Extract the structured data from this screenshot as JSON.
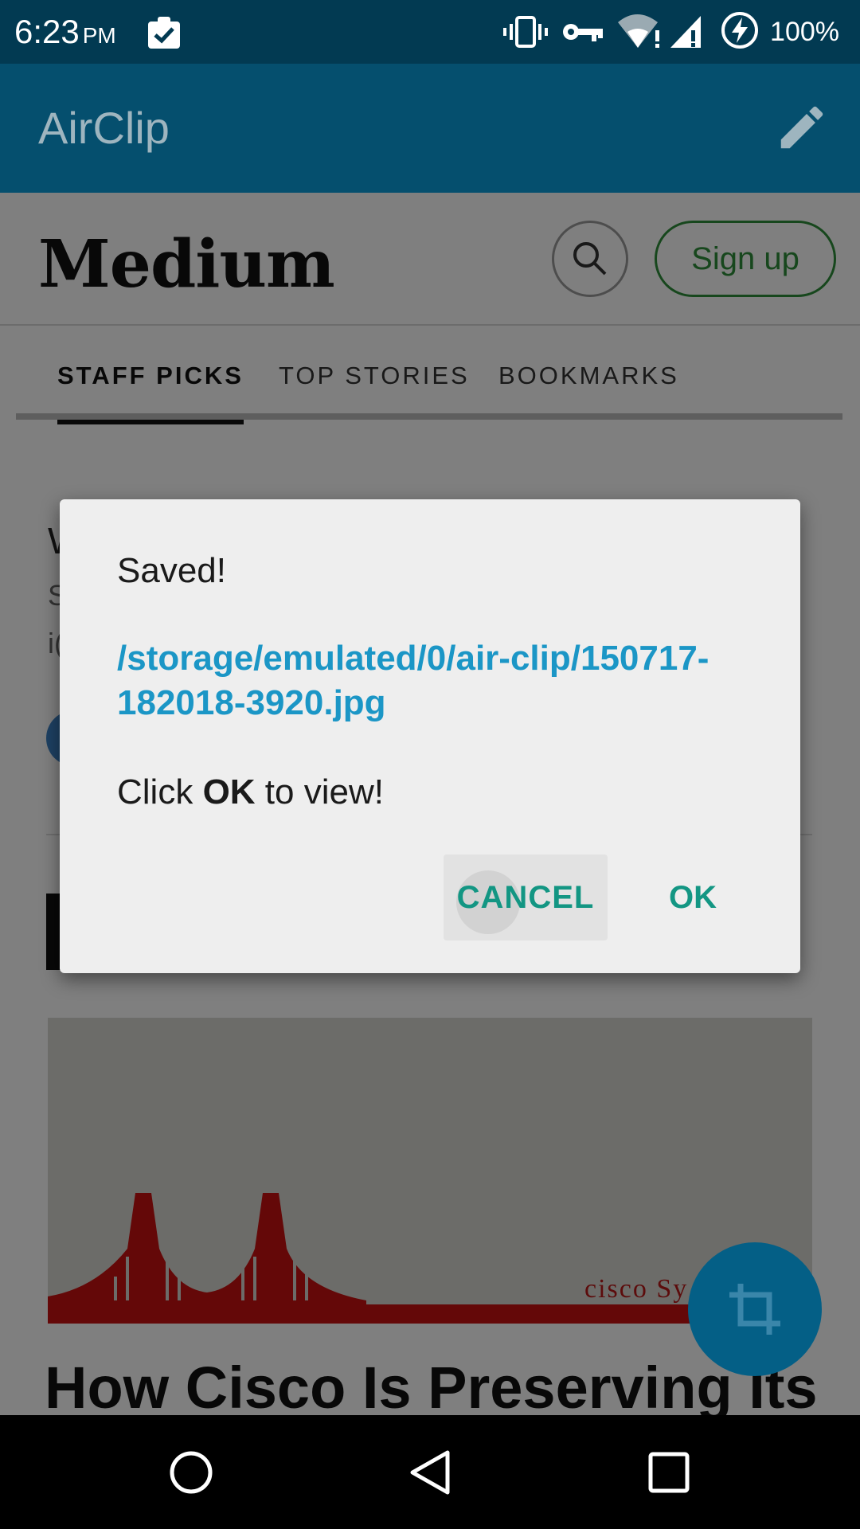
{
  "status_bar": {
    "time": "6:23",
    "ampm": "PM",
    "battery": "100%",
    "icons": [
      "clipboard-check-icon",
      "vibrate-icon",
      "vpn-key-icon",
      "wifi-alert-icon",
      "signal-alert-icon",
      "battery-charging-icon"
    ]
  },
  "app_bar": {
    "title": "AirClip",
    "action_icon": "pencil-icon"
  },
  "web": {
    "logo": "Medium",
    "search_icon": "search-icon",
    "signup_label": "Sign up",
    "tabs": [
      {
        "label": "STAFF PICKS",
        "active": true
      },
      {
        "label": "TOP STORIES",
        "active": false
      },
      {
        "label": "BOOKMARKS",
        "active": false
      }
    ],
    "peek": {
      "w": "W",
      "s": "S",
      "i": "i("
    },
    "image_brand_text": "cisco Sy",
    "story_title": "How Cisco Is Preserving Its"
  },
  "fab": {
    "icon": "crop-icon"
  },
  "dialog": {
    "title": "Saved!",
    "path": "/storage/emulated/0/air-clip/150717-182018-3920.jpg",
    "message_prefix": "Click ",
    "message_bold": "OK",
    "message_suffix": " to view!",
    "cancel_label": "CANCEL",
    "ok_label": "OK"
  },
  "nav_bar": {
    "icons": [
      "home-icon",
      "back-icon",
      "recents-icon"
    ]
  },
  "colors": {
    "status_bar": "#023a52",
    "app_bar": "#054f6e",
    "accent_link": "#1b96c6",
    "dialog_button": "#139683",
    "signup_green": "#2f8f3a"
  }
}
